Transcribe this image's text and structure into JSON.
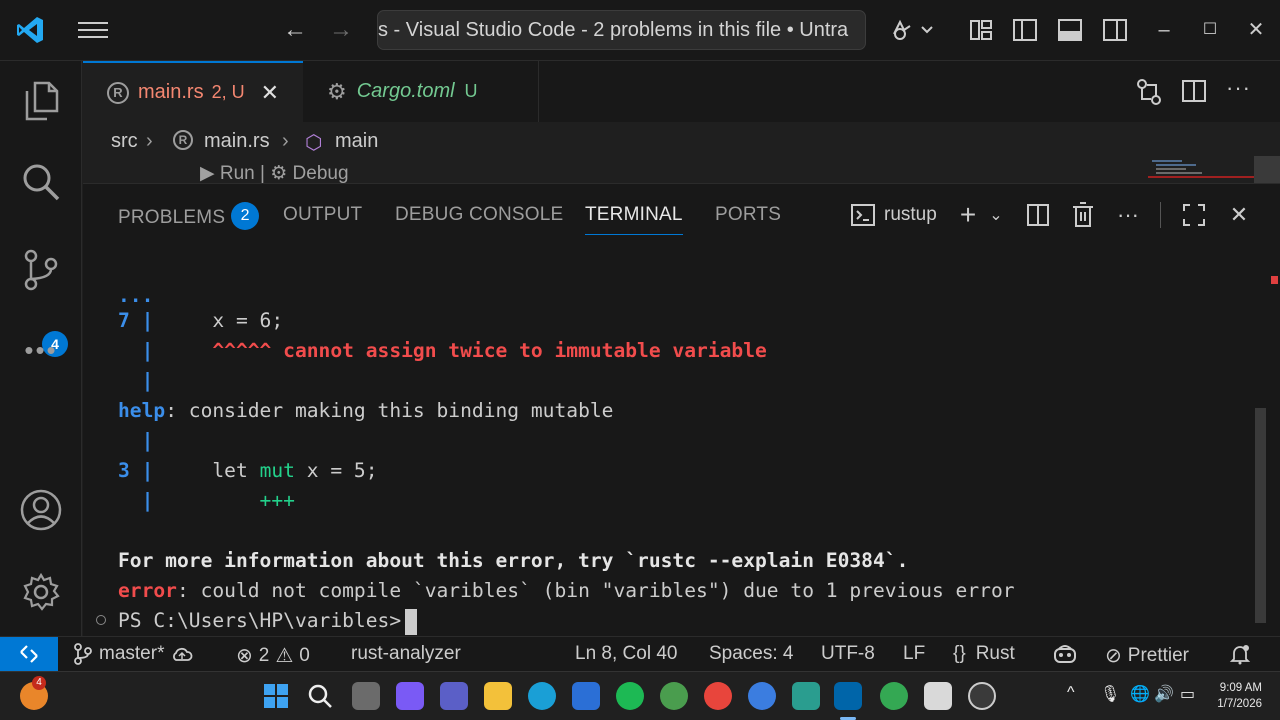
{
  "titlebar": {
    "title": "s - Visual Studio Code - 2 problems in this file • Untra",
    "icons": [
      "vscode-logo",
      "hamburger-menu",
      "back-arrow",
      "forward-arrow",
      "copilot-icon",
      "customize-layout-icon",
      "toggle-primary-sidebar-icon",
      "toggle-panel-icon",
      "toggle-secondary-sidebar-icon",
      "minimize",
      "maximize",
      "close"
    ]
  },
  "activity": {
    "items": [
      "explorer",
      "search",
      "source-control",
      "more"
    ],
    "source_control_badge": "4",
    "bottom": [
      "accounts",
      "manage"
    ]
  },
  "tabs": [
    {
      "name": "main.rs",
      "status": "2, U",
      "active": true,
      "color": "#f48771"
    },
    {
      "name": "Cargo.toml",
      "status": "U",
      "active": false,
      "color": "#73c991"
    }
  ],
  "breadcrumb": {
    "items": [
      "src",
      "main.rs",
      "main"
    ]
  },
  "codelens": {
    "run": "▶ Run",
    "sep": "|",
    "debug": "⚙ Debug"
  },
  "panel": {
    "tabs": [
      {
        "label": "PROBLEMS",
        "badge": "2"
      },
      {
        "label": "OUTPUT"
      },
      {
        "label": "DEBUG CONSOLE"
      },
      {
        "label": "TERMINAL",
        "active": true
      },
      {
        "label": "PORTS"
      }
    ],
    "terminal_name": "rustup"
  },
  "terminal": {
    "l1": "...",
    "l2_num": "7 |",
    "l2_code": "     x = 6;",
    "l3_bar": "  |",
    "l3_carets": "     ^^^^^ cannot assign twice to immutable variable",
    "l4_bar": "  |",
    "l5_help": "help",
    "l5_rest": ": consider making this binding mutable",
    "l6_bar": "  |",
    "l7_num": "3 |",
    "l7_pre": "     let ",
    "l7_mut": "mut",
    "l7_post": " x = 5;",
    "l8_bar": "  |",
    "l8_plus": "         +++",
    "l9": "For more information about this error, try `rustc --explain E0384`.",
    "l10_err": "error",
    "l10_rest": ": could not compile `varibles` (bin \"varibles\") due to 1 previous error",
    "l11_prompt": "PS C:\\Users\\HP\\varibles>"
  },
  "statusbar": {
    "branch": "master*",
    "errors": "2",
    "warnings": "0",
    "analyzer": "rust-analyzer",
    "position": "Ln 8, Col 40",
    "spaces": "Spaces: 4",
    "encoding": "UTF-8",
    "eol": "LF",
    "language": "Rust",
    "formatter": "Prettier"
  },
  "taskbar": {
    "widget_badge": "4",
    "time": "9:09 AM",
    "date": "1/7/2026"
  },
  "colors": {
    "accent": "#0078d4",
    "error": "#f14c4c",
    "help": "#3b8eea",
    "added": "#23d18b"
  }
}
